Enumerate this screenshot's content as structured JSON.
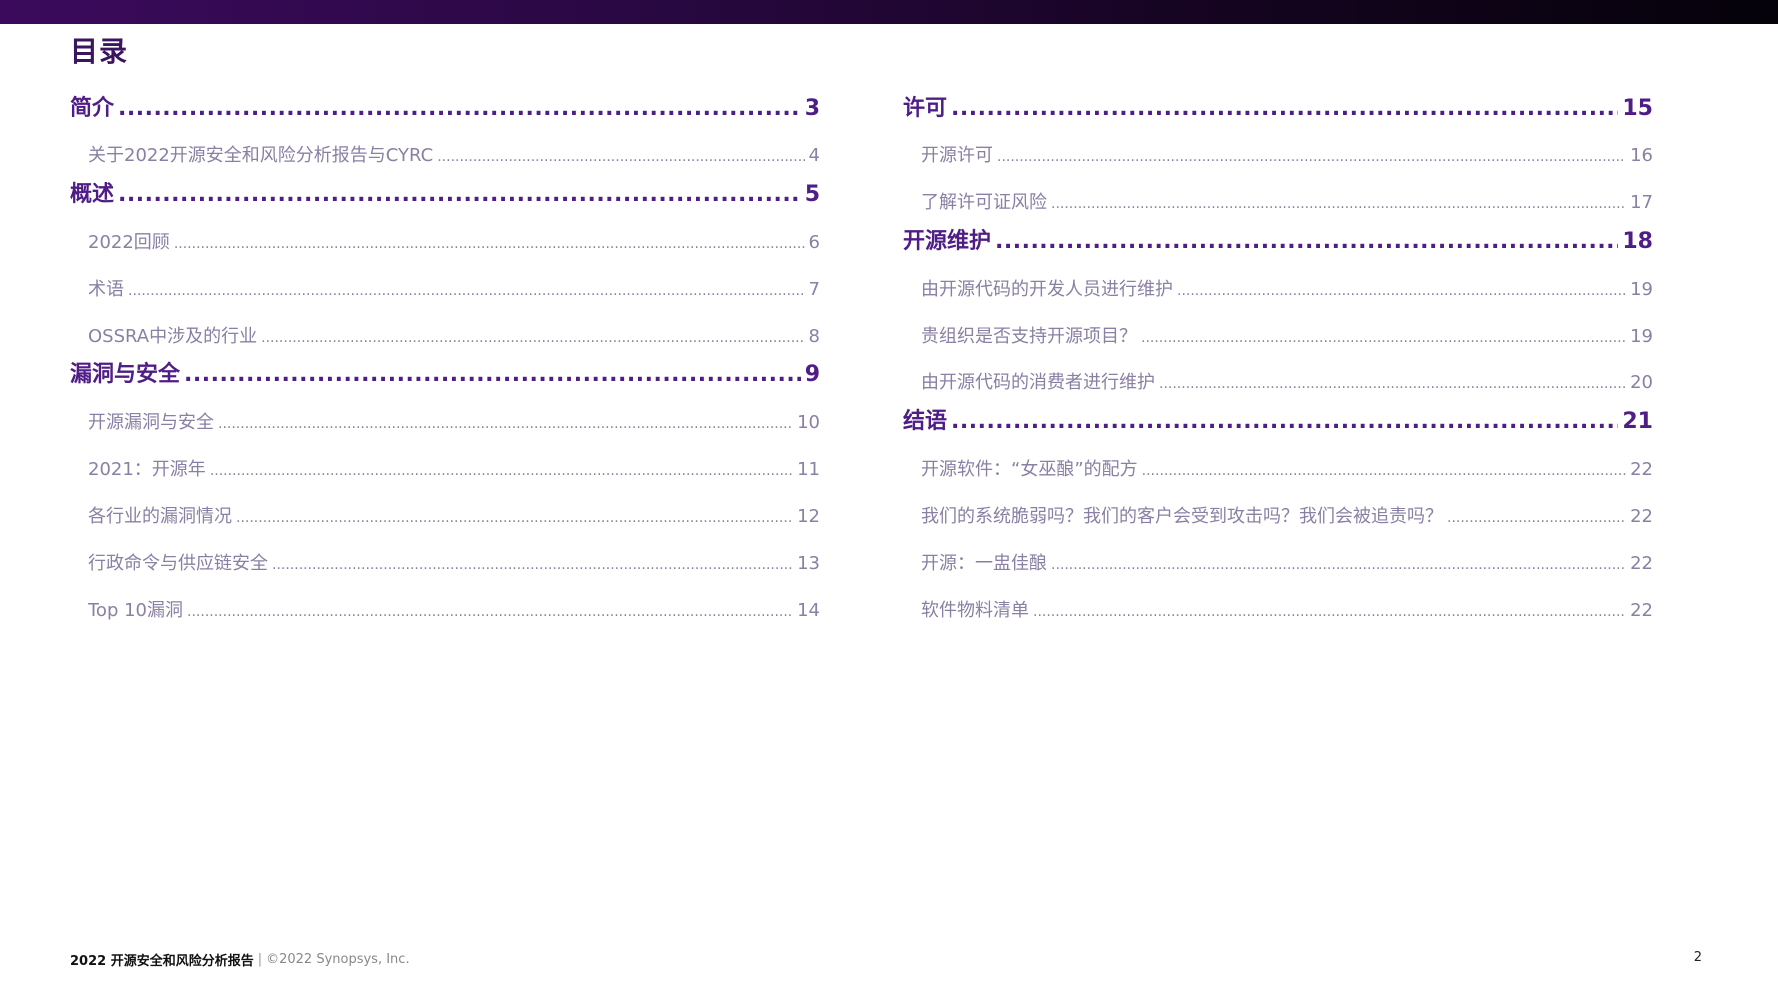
{
  "title": "目录",
  "left_column": [
    {
      "kind": "section",
      "label": "简介",
      "page": "3"
    },
    {
      "kind": "sub",
      "label": "关于2022开源安全和风险分析报告与CYRC",
      "page": "4"
    },
    {
      "kind": "section",
      "label": "概述",
      "page": "5"
    },
    {
      "kind": "sub",
      "label": "2022回顾",
      "page": "6"
    },
    {
      "kind": "sub",
      "label": "术语",
      "page": "7"
    },
    {
      "kind": "sub",
      "label": "OSSRA中涉及的行业",
      "page": "8"
    },
    {
      "kind": "section",
      "label": "漏洞与安全",
      "page": "9"
    },
    {
      "kind": "sub",
      "label": "开源漏洞与安全",
      "page": "10"
    },
    {
      "kind": "sub",
      "label": "2021：开源年",
      "page": "11"
    },
    {
      "kind": "sub",
      "label": "各行业的漏洞情况",
      "page": "12"
    },
    {
      "kind": "sub",
      "label": "行政命令与供应链安全",
      "page": "13"
    },
    {
      "kind": "sub",
      "label": "Top 10漏洞",
      "page": "14"
    }
  ],
  "right_column": [
    {
      "kind": "section",
      "label": "许可",
      "page": "15"
    },
    {
      "kind": "sub",
      "label": "开源许可",
      "page": "16"
    },
    {
      "kind": "sub",
      "label": "了解许可证风险",
      "page": "17"
    },
    {
      "kind": "section",
      "label": "开源维护",
      "page": "18"
    },
    {
      "kind": "sub",
      "label": "由开源代码的开发人员进行维护",
      "page": "19"
    },
    {
      "kind": "sub",
      "label": "贵组织是否支持开源项目？",
      "page": "19"
    },
    {
      "kind": "sub",
      "label": "由开源代码的消费者进行维护",
      "page": "20"
    },
    {
      "kind": "section",
      "label": "结语",
      "page": "21"
    },
    {
      "kind": "sub",
      "label": "开源软件：“女巫酿”的配方",
      "page": "22"
    },
    {
      "kind": "sub",
      "label": "我们的系统脆弱吗？我们的客户会受到攻击吗？我们会被追责吗？",
      "page": "22"
    },
    {
      "kind": "sub",
      "label": "开源：一盅佳酿",
      "page": "22"
    },
    {
      "kind": "sub",
      "label": "软件物料清单",
      "page": "22"
    }
  ],
  "footer": {
    "report": "2022 开源安全和风险分析报告",
    "separator": "|",
    "copyright": "©2022 Synopsys, Inc."
  },
  "page_number": "2",
  "colors": {
    "section": "#4f1d86",
    "sub": "#8a80a3",
    "title": "#3a1660"
  }
}
